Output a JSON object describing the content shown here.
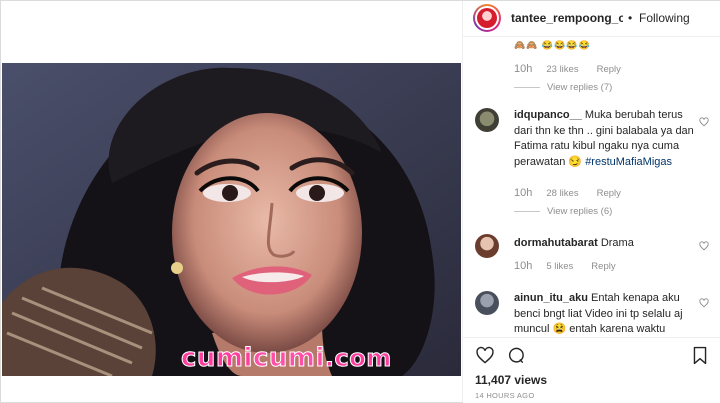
{
  "post": {
    "watermark_part1": "cumi",
    "watermark_part2": "cumi",
    "watermark_part3": ".com"
  },
  "header": {
    "username": "tantee_rempoong_offic",
    "separator": "•",
    "follow_status": "Following"
  },
  "comments": [
    {
      "emoji_preview": "🙈🙈 😂😂😂😂",
      "age": "10h",
      "likes": "23 likes",
      "reply": "Reply",
      "view_replies": "View replies (7)"
    },
    {
      "username": "idqupanco__",
      "text": "Muka berubah terus dari thn ke thn .. gini balabala ya dan Fatima ratu kibul ngaku nya cuma perawatan 😏",
      "hashtag": "#restuMafiaMigas",
      "age": "10h",
      "likes": "28 likes",
      "reply": "Reply",
      "view_replies": "View replies (6)"
    },
    {
      "username": "dormahutabarat",
      "text": "Drama",
      "age": "10h",
      "likes": "5 likes",
      "reply": "Reply"
    },
    {
      "username": "ainun_itu_aku",
      "text": "Entah kenapa aku benci bngt liat Video ini tp selalu aj muncul 😫 entah karena waktu"
    }
  ],
  "footer": {
    "views": "11,407 views",
    "time_ago": "14 HOURS AGO"
  },
  "icons": {
    "heart": "heart-outline-icon",
    "comment": "comment-bubble-icon",
    "save": "bookmark-icon"
  },
  "colors": {
    "link": "#003569",
    "muted": "#8e8e8e",
    "watermark": "#ff3d9e"
  }
}
